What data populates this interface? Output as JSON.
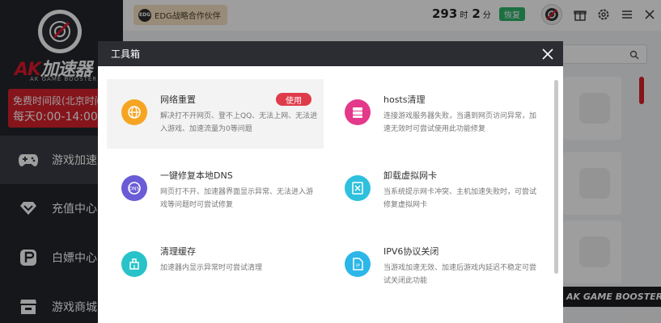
{
  "sidebar": {
    "brand_ak": "AK",
    "brand_cn": "加速器",
    "brand_sub": "AK GAME BOOSTER",
    "promo_line1": "免费时间段(北京时间)",
    "promo_line2": "每天0:00-14:00",
    "nav": [
      {
        "label": "游戏加速",
        "icon": "gamepad-icon",
        "active": true
      },
      {
        "label": "充值中心",
        "icon": "diamond-icon",
        "active": false
      },
      {
        "label": "白嫖中心",
        "icon": "flag-icon",
        "active": false
      },
      {
        "label": "游戏商城",
        "icon": "store-icon",
        "active": false
      }
    ]
  },
  "topbar": {
    "partner_badge": "EDG",
    "partner_label": "EDG战略合作伙伴",
    "timer_hours": "293",
    "timer_hours_unit": "时",
    "timer_minutes": "2",
    "timer_minutes_unit": "分",
    "restore_label": "恢复",
    "icons": [
      "avatar",
      "gift-icon",
      "gear-icon",
      "menu-icon",
      "close-icon"
    ]
  },
  "background": {
    "banner_text": "AK GAME BOOSTER"
  },
  "modal": {
    "title": "工具箱",
    "tools": [
      {
        "name": "网络重置",
        "desc": "解决打不开网页、登不上QQ、无法上网、无法进入游戏、加速流量为0等问题",
        "action": "使用",
        "icon": "network-icon",
        "color": "#f6a523"
      },
      {
        "name": "hosts清理",
        "desc": "连接游戏服务器失败，当遇到网页访问异常，加速无效时可尝试使用此功能修复",
        "icon": "server-icon",
        "color": "#e4388a"
      },
      {
        "name": "一键修复本地DNS",
        "desc": "网页打不开、加速器界面显示异常、无法进入游戏等问题时可尝试修复",
        "icon": "dns-icon",
        "color": "#6a5bd6"
      },
      {
        "name": "卸载虚拟网卡",
        "desc": "当系统提示网卡冲突、主机加速失败时，可尝试修复虚拟网卡",
        "icon": "network-card-icon",
        "color": "#2ec0dd"
      },
      {
        "name": "清理缓存",
        "desc": "加速器内显示异常时可尝试清理",
        "icon": "broom-icon",
        "color": "#27c3c9"
      },
      {
        "name": "IPV6协议关闭",
        "desc": "当游戏加速无效、加速后游戏内延迟不稳定可尝试关闭此功能",
        "icon": "ipv6-icon",
        "color": "#2cb7e8"
      }
    ]
  }
}
